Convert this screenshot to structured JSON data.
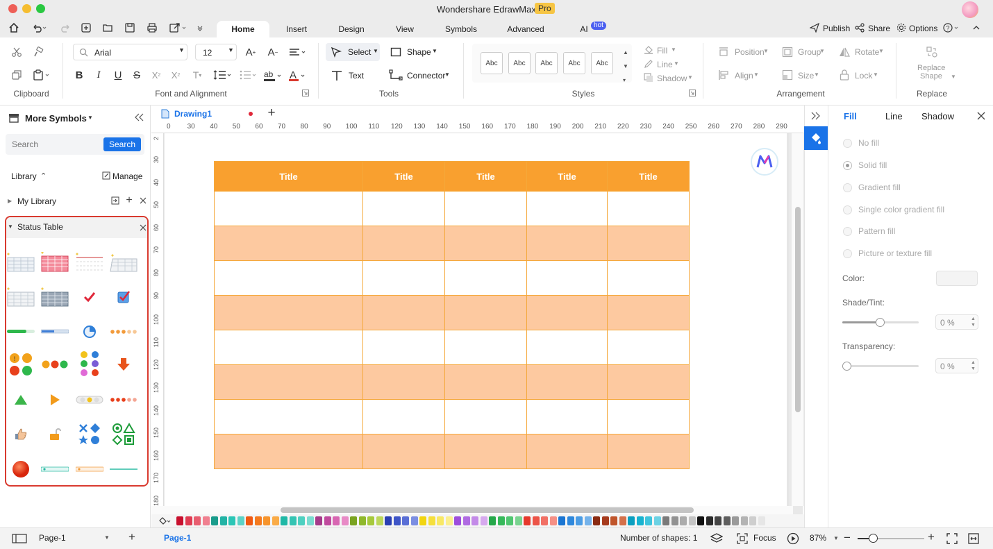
{
  "app": {
    "title": "Wondershare EdrawMax",
    "badge": "Pro"
  },
  "menu": {
    "tabs": [
      "Home",
      "Insert",
      "Design",
      "View",
      "Symbols",
      "Advanced",
      "AI"
    ],
    "ai_badge": "hot",
    "publish": "Publish",
    "share": "Share",
    "options": "Options"
  },
  "ribbon": {
    "clipboard": "Clipboard",
    "font_name": "Arial",
    "font_size": "12",
    "font_group": "Font and Alignment",
    "select": "Select",
    "shape": "Shape",
    "text": "Text",
    "connector": "Connector",
    "tools": "Tools",
    "abc": [
      "Abc",
      "Abc",
      "Abc",
      "Abc",
      "Abc"
    ],
    "fill": "Fill",
    "line": "Line",
    "shadow": "Shadow",
    "styles": "Styles",
    "position": "Position",
    "group": "Group",
    "rotate": "Rotate",
    "align": "Align",
    "size": "Size",
    "lock": "Lock",
    "arrangement": "Arrangement",
    "replace_shape_1": "Replace",
    "replace_shape_2": "Shape",
    "replace": "Replace"
  },
  "left": {
    "title": "More Symbols",
    "search_placeholder": "Search",
    "search_button": "Search",
    "library": "Library",
    "manage": "Manage",
    "my_library": "My Library",
    "status_table": "Status Table"
  },
  "document": {
    "tab": "Drawing1",
    "ruler_x": [
      "0",
      "30",
      "40",
      "50",
      "60",
      "70",
      "80",
      "90",
      "100",
      "110",
      "120",
      "130",
      "140",
      "150",
      "160",
      "170",
      "180",
      "190",
      "200",
      "210",
      "220",
      "230",
      "240",
      "250",
      "260",
      "270",
      "280",
      "290"
    ],
    "ruler_y": [
      "2",
      "30",
      "40",
      "50",
      "60",
      "70",
      "80",
      "90",
      "100",
      "110",
      "120",
      "130",
      "140",
      "150",
      "160",
      "170",
      "180"
    ],
    "table_headers": [
      "Title",
      "Title",
      "Title",
      "Title",
      "Title"
    ],
    "table_rows": 8
  },
  "right": {
    "tabs": [
      "Fill",
      "Line",
      "Shadow"
    ],
    "fill_options": [
      "No fill",
      "Solid fill",
      "Gradient fill",
      "Single color gradient fill",
      "Pattern fill",
      "Picture or texture fill"
    ],
    "color": "Color:",
    "shade": "Shade/Tint:",
    "shade_value": "0 %",
    "transparency": "Transparency:",
    "transparency_value": "0 %"
  },
  "status": {
    "page_select": "Page-1",
    "page_tab": "Page-1",
    "shapes": "Number of shapes: 1",
    "focus": "Focus",
    "zoom": "87%"
  },
  "colors": {
    "accent": "#1a73e8",
    "table_header": "#f9a02f",
    "table_alt": "#fdc9a0",
    "selection": "#d93a2f"
  },
  "palette": [
    "#c8102e",
    "#e03c52",
    "#e85d6f",
    "#f08090",
    "#1a9c8c",
    "#22b3a5",
    "#2bc6b6",
    "#5dd3c7",
    "#f05a14",
    "#f47a1f",
    "#f7942c",
    "#faab47",
    "#1fb8a6",
    "#34c4b3",
    "#4ed0c0",
    "#7adcd0",
    "#a53b8a",
    "#c04a9e",
    "#d866b2",
    "#e88ac6",
    "#7aa320",
    "#8fb82b",
    "#a6c93c",
    "#bcd75a",
    "#2b3fb3",
    "#3e55c7",
    "#5a6fd6",
    "#7b8ee2",
    "#f2d50f",
    "#f5df3b",
    "#f8e865",
    "#fbef8e",
    "#9d4edd",
    "#b06be2",
    "#c38ae8",
    "#d6a9ee",
    "#25a84a",
    "#36b95a",
    "#50c670",
    "#7ad390",
    "#e6382c",
    "#ec5448",
    "#f17065",
    "#f59086",
    "#1a75d2",
    "#2e88dc",
    "#4b9ce4",
    "#74b2ea",
    "#8a2b12",
    "#a63b1d",
    "#c0552b",
    "#d4704a",
    "#0a9fc0",
    "#17b3d0",
    "#3ec4dc",
    "#6cd2e4",
    "#7a7a7a",
    "#929292",
    "#ababab",
    "#c4c4c4",
    "#111111",
    "#2a2a2a",
    "#444444",
    "#5e5e5e",
    "#9a9a9a",
    "#b4b4b4",
    "#cecece",
    "#e6e6e6"
  ]
}
